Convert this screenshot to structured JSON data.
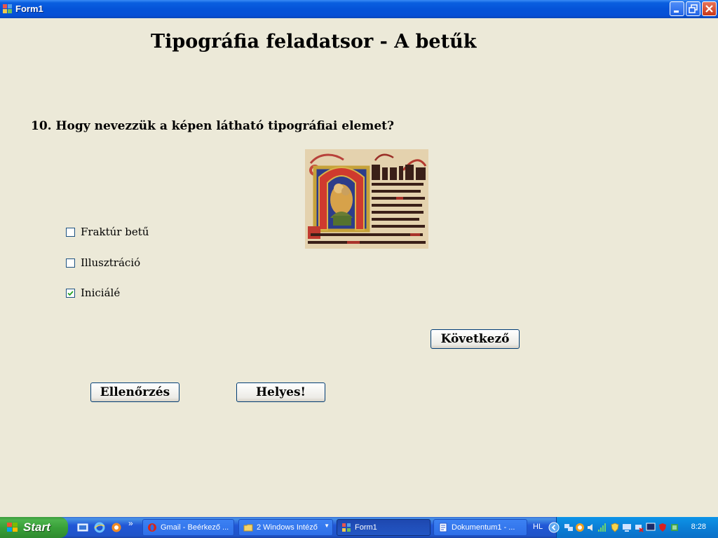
{
  "window": {
    "title": "Form1"
  },
  "heading": "Tipográfia feladatsor - A betűk",
  "question": "10. Hogy nevezzük a képen látható tipográfiai elemet?",
  "image": {
    "subject": "illuminated-initial-manuscript"
  },
  "options": [
    {
      "label": "Fraktúr betű",
      "checked": false
    },
    {
      "label": "Illusztráció",
      "checked": false
    },
    {
      "label": "Iniciálé",
      "checked": true
    }
  ],
  "buttons": {
    "next": "Következő",
    "check": "Ellenőrzés",
    "result": "Helyes!"
  },
  "taskbar": {
    "start": "Start",
    "tasks": [
      {
        "label": "Gmail - Beérkező ...",
        "icon": "opera-icon",
        "active": false
      },
      {
        "label": "2 Windows Intéző",
        "icon": "folder-icon",
        "active": false
      },
      {
        "label": "Form1",
        "icon": "form-icon",
        "active": true
      },
      {
        "label": "Dokumentum1 - ...",
        "icon": "word-icon",
        "active": false
      }
    ],
    "chevron": "»",
    "language": "HL",
    "clock": "8:28"
  }
}
